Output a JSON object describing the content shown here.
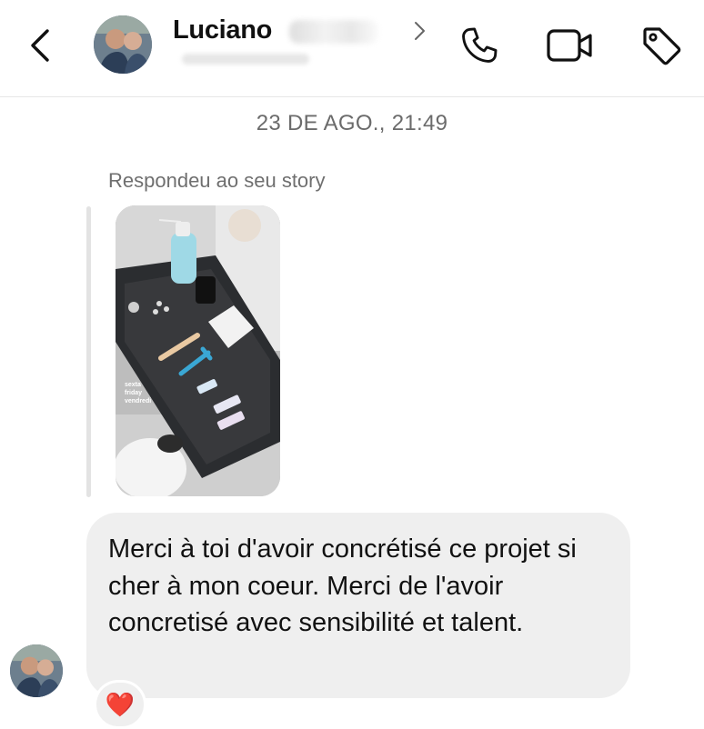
{
  "header": {
    "contact_name": "Luciano",
    "icons": {
      "back": "chevron-left-icon",
      "profile_chevron": "chevron-right-icon",
      "call": "phone-icon",
      "video": "video-camera-icon",
      "tag": "tag-icon"
    }
  },
  "thread": {
    "timestamp": "23 DE AGO., 21:49",
    "reply_label": "Respondeu ao seu story",
    "story": {
      "caption_lines": [
        "sexta",
        "friday",
        "vendredi"
      ]
    },
    "message": {
      "text": "Merci à toi d'avoir concrétisé  ce projet si cher à mon coeur.  Merci de l'avoir concretisé avec sensibilité et talent."
    },
    "reaction": {
      "emoji": "❤️"
    }
  },
  "colors": {
    "background": "#ffffff",
    "bubble": "#efefef",
    "muted_text": "#6b6b6b",
    "heart": "#e0245e"
  }
}
